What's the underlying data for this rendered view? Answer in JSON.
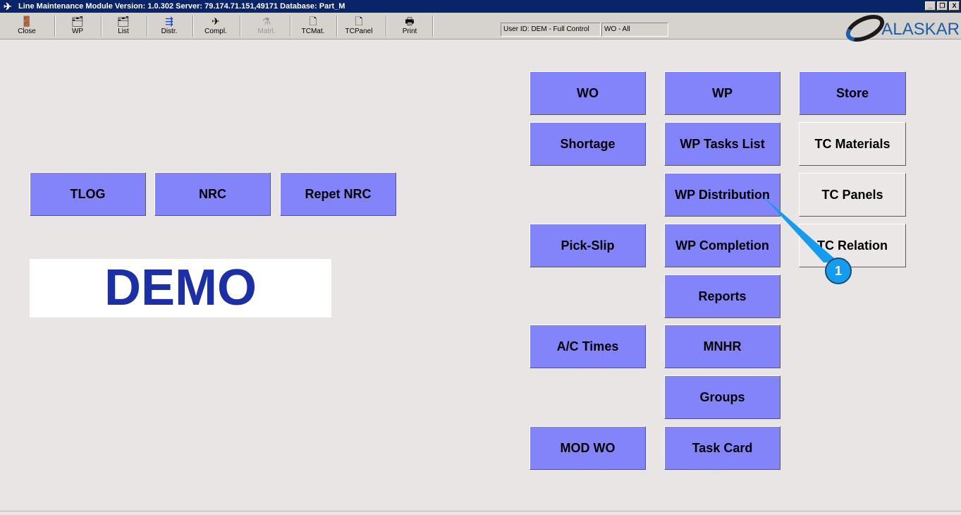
{
  "title": "Line Maintenance Module  Version: 1.0.302 Server: 79.174.71.151,49171 Database: Part_M",
  "window_controls": {
    "minimize": "_",
    "restore": "❐",
    "close": "X"
  },
  "toolbar": [
    {
      "label": "Close",
      "icon": "door-exit-icon",
      "glyph": "🚪",
      "disabled": false
    },
    {
      "label": "WP",
      "icon": "printer-folder-icon",
      "glyph": "🗂",
      "disabled": false
    },
    {
      "label": "List",
      "icon": "list-folder-icon",
      "glyph": "🗂",
      "disabled": false
    },
    {
      "label": "Distr.",
      "icon": "distribution-icon",
      "glyph": "⇶",
      "disabled": false
    },
    {
      "label": "Compl.",
      "icon": "completion-icon",
      "glyph": "✈",
      "disabled": false
    },
    {
      "label": "Matrl.",
      "icon": "flask-icon",
      "glyph": "⚗",
      "disabled": true
    },
    {
      "label": "TCMat.",
      "icon": "document-icon",
      "glyph": "🗋",
      "disabled": false
    },
    {
      "label": "TCPanel",
      "icon": "document-icon",
      "glyph": "🗋",
      "disabled": false
    },
    {
      "label": "Print",
      "icon": "print-icon",
      "glyph": "🖶",
      "disabled": false
    }
  ],
  "status": {
    "user": "User ID: DEM - Full Control",
    "wo": "WO - All"
  },
  "logo": "ALASKAR",
  "left_buttons": [
    "TLOG",
    "NRC",
    "Repet NRC"
  ],
  "demo_label": "DEMO",
  "col1": [
    "WO",
    "Shortage",
    "Pick-Slip",
    "A/C Times",
    "MOD WO"
  ],
  "col2": [
    "WP",
    "WP Tasks List",
    "WP Distribution",
    "WP Completion",
    "Reports",
    "MNHR",
    "Groups",
    "Task Card"
  ],
  "col3": [
    "Store",
    "TC Materials",
    "TC Panels",
    "TC Relation"
  ],
  "callout": "1",
  "colors": {
    "button": "#8383fa",
    "titlebar": "#0a246a",
    "callout": "#139cf0"
  }
}
